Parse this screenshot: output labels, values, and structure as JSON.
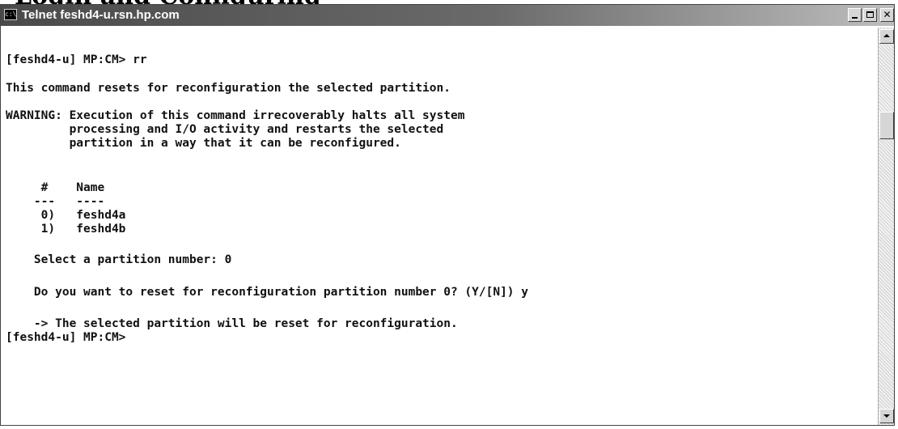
{
  "page": {
    "clipped_heading": "Login and Configuring"
  },
  "window": {
    "title": "Telnet feshd4-u.rsn.hp.com",
    "icon": "console-icon",
    "icon_glyph": "c:\\"
  },
  "console": {
    "lines": [
      "[feshd4-u] MP:CM> rr",
      "This command resets for reconfiguration the selected partition.",
      "WARNING: Execution of this command irrecoverably halts all system",
      "         processing and I/O activity and restarts the selected",
      "         partition in a way that it can be reconfigured.",
      "     #    Name",
      "    ---   ----",
      "     0)   feshd4a",
      "     1)   feshd4b",
      "    Select a partition number: 0",
      "    Do you want to reset for reconfiguration partition number 0? (Y/[N]) y",
      "    -> The selected partition will be reset for reconfiguration.",
      "[feshd4-u] MP:CM>"
    ]
  },
  "scrollbar": {
    "up_icon": "arrow-up-icon",
    "down_icon": "arrow-down-icon",
    "position": 0.18
  },
  "colors": {
    "console_background": "#ffffff",
    "console_text": "#111111",
    "titlebar_start": "#4a4a4a",
    "titlebar_end": "#bdbdbd"
  }
}
